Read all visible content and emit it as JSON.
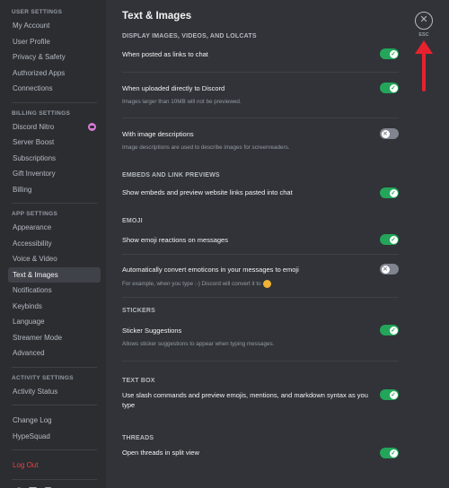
{
  "sidebar": {
    "user_settings_header": "USER SETTINGS",
    "user_items": [
      "My Account",
      "User Profile",
      "Privacy & Safety",
      "Authorized Apps",
      "Connections"
    ],
    "billing_header": "BILLING SETTINGS",
    "billing_items": [
      "Discord Nitro",
      "Server Boost",
      "Subscriptions",
      "Gift Inventory",
      "Billing"
    ],
    "app_header": "APP SETTINGS",
    "app_items": [
      "Appearance",
      "Accessibility",
      "Voice & Video",
      "Text & Images",
      "Notifications",
      "Keybinds",
      "Language",
      "Streamer Mode",
      "Advanced"
    ],
    "activity_header": "ACTIVITY SETTINGS",
    "activity_items": [
      "Activity Status"
    ],
    "misc_items": [
      "Change Log",
      "HypeSquad"
    ],
    "logout": "Log Out",
    "social_icons": [
      "twitter-icon",
      "facebook-icon",
      "instagram-icon"
    ]
  },
  "main": {
    "title": "Text & Images",
    "display_header": "DISPLAY IMAGES, VIDEOS, AND LOLCATS",
    "links_label": "When posted as links to chat",
    "uploaded_label": "When uploaded directly to Discord",
    "uploaded_desc": "Images larger than 10MB will not be previewed.",
    "descriptions_label": "With image descriptions",
    "descriptions_desc": "Image descriptions are used to describe images for screenreaders.",
    "embeds_header": "EMBEDS AND LINK PREVIEWS",
    "embeds_label": "Show embeds and preview website links pasted into chat",
    "emoji_header": "EMOJI",
    "emoji_label": "Show emoji reactions on messages",
    "emoticons_label": "Automatically convert emoticons in your messages to emoji",
    "emoticons_desc": "For example, when you type :-) Discord will convert it to",
    "stickers_header": "STICKERS",
    "stickers_label": "Sticker Suggestions",
    "stickers_desc": "Allows sticker suggestions to appear when typing messages.",
    "textbox_header": "TEXT BOX",
    "textbox_label": "Use slash commands and preview emojis, mentions, and markdown syntax as you type",
    "threads_header": "THREADS",
    "threads_label": "Open threads in split view"
  },
  "toggles": {
    "links": true,
    "uploaded": true,
    "descriptions": false,
    "embeds": true,
    "emoji": true,
    "emoticons": false,
    "stickers": true,
    "textbox": true,
    "threads": true
  },
  "close": {
    "icon": "close-icon",
    "label": "ESC"
  },
  "colors": {
    "toggle_on": "#23a55a",
    "toggle_off": "#80848e",
    "selected": "#404249",
    "danger": "#f23f43",
    "arrow": "#e8212e"
  }
}
